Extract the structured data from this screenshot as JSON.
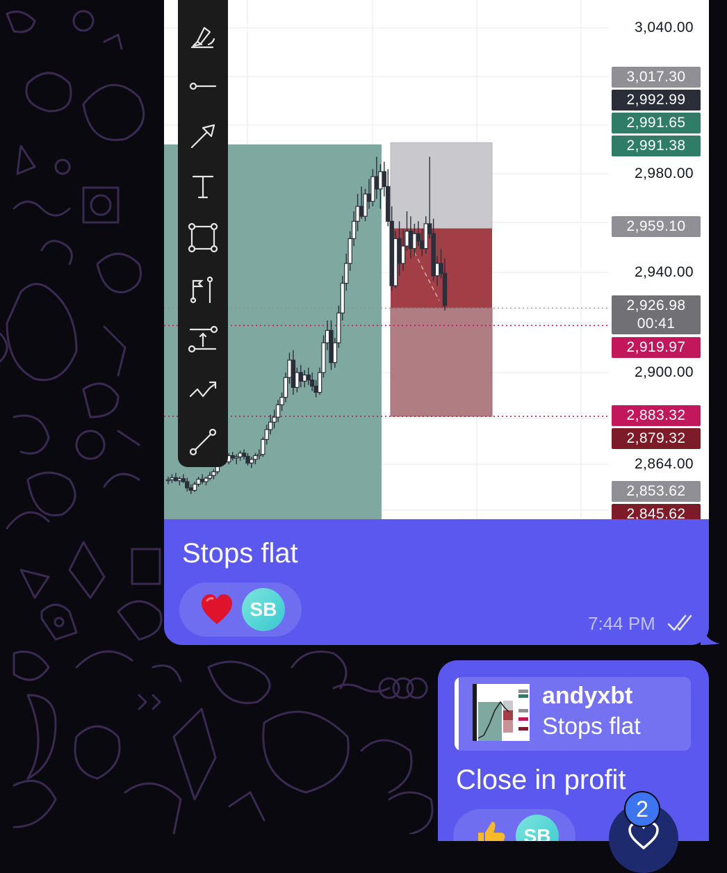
{
  "message1": {
    "caption": "Stops flat",
    "time": "7:44 PM",
    "reactions": [
      {
        "emoji": "heart-emoji"
      },
      {
        "avatar_initials": "SB"
      }
    ]
  },
  "message2": {
    "reply": {
      "author": "andyxbt",
      "text": "Stops flat"
    },
    "caption": "Close in profit",
    "reactions": [
      {
        "emoji": "thumbs-up-emoji"
      },
      {
        "avatar_initials": "SB"
      }
    ],
    "scroll_badge_count": "2"
  },
  "toolbar": {
    "tools": [
      "brush-icon",
      "horizontal-ray-icon",
      "arrow-icon",
      "text-icon",
      "rectangle-icon",
      "flag-pin-icon",
      "price-range-icon",
      "path-icon",
      "trend-line-icon"
    ]
  },
  "chart": {
    "axis_labels": [
      "3,040.00",
      "2,980.00",
      "2,940.00",
      "2,900.00",
      "2,864.00"
    ],
    "price_tags": [
      {
        "value": "3,017.30",
        "color": "#8f8f95"
      },
      {
        "value": "2,992.99",
        "color": "#2a2e39"
      },
      {
        "value": "2,991.65",
        "color": "#2f7d67"
      },
      {
        "value": "2,991.38",
        "color": "#2f7d67"
      },
      {
        "value": "2,959.10",
        "color": "#8f8f95"
      },
      {
        "value": "2,926.98",
        "sub": "00:41",
        "color": "#707075"
      },
      {
        "value": "2,919.97",
        "color": "#c2185b"
      },
      {
        "value": "2,883.32",
        "color": "#c2185b"
      },
      {
        "value": "2,879.32",
        "color": "#7d1c28"
      },
      {
        "value": "2,853.62",
        "color": "#8f8f95"
      },
      {
        "value": "2,845.62",
        "color": "#7d1c28"
      }
    ]
  },
  "colors": {
    "bubble": "#5a58ee",
    "long_zone": "#7fa8a0",
    "stop_zone": "#a13e46",
    "target_zone": "#c9c9cd"
  },
  "chart_data": {
    "type": "candlestick",
    "ylim": [
      2840,
      3048
    ],
    "zones": [
      {
        "name": "long position",
        "top": 2992.99,
        "bottom": 2845.62
      },
      {
        "name": "short target",
        "top": 2993.7,
        "bottom": 2959.1
      },
      {
        "name": "short stop",
        "top": 2959.1,
        "bottom": 2926.98
      },
      {
        "name": "short stop extension",
        "top": 2926.98,
        "bottom": 2883.32
      }
    ],
    "lines": [
      2926.98,
      2919.97,
      2883.32
    ],
    "candles": [
      {
        "o": 2857.5,
        "h": 2859,
        "l": 2856,
        "c": 2857.8
      },
      {
        "o": 2857.8,
        "h": 2860,
        "l": 2856.5,
        "c": 2858.6
      },
      {
        "o": 2858.6,
        "h": 2860.5,
        "l": 2857,
        "c": 2857.4
      },
      {
        "o": 2857.4,
        "h": 2859,
        "l": 2855.5,
        "c": 2858.2
      },
      {
        "o": 2858.2,
        "h": 2860,
        "l": 2856.5,
        "c": 2857
      },
      {
        "o": 2857,
        "h": 2858.5,
        "l": 2853,
        "c": 2854.5
      },
      {
        "o": 2854.5,
        "h": 2856,
        "l": 2852,
        "c": 2853.5
      },
      {
        "o": 2853.5,
        "h": 2857,
        "l": 2852.8,
        "c": 2856
      },
      {
        "o": 2856,
        "h": 2859,
        "l": 2855,
        "c": 2858
      },
      {
        "o": 2858,
        "h": 2860,
        "l": 2856,
        "c": 2857
      },
      {
        "o": 2857,
        "h": 2859,
        "l": 2855.5,
        "c": 2858.4
      },
      {
        "o": 2858.4,
        "h": 2861,
        "l": 2857.5,
        "c": 2859.5
      },
      {
        "o": 2859.5,
        "h": 2862,
        "l": 2858,
        "c": 2861
      },
      {
        "o": 2861,
        "h": 2866,
        "l": 2860,
        "c": 2865
      },
      {
        "o": 2865,
        "h": 2868,
        "l": 2863,
        "c": 2866
      },
      {
        "o": 2866,
        "h": 2869,
        "l": 2864,
        "c": 2865
      },
      {
        "o": 2865,
        "h": 2868.5,
        "l": 2864,
        "c": 2867.5
      },
      {
        "o": 2867.5,
        "h": 2869,
        "l": 2865.5,
        "c": 2866.5
      },
      {
        "o": 2866.5,
        "h": 2868,
        "l": 2864,
        "c": 2867
      },
      {
        "o": 2867,
        "h": 2869.5,
        "l": 2865.5,
        "c": 2868.5
      },
      {
        "o": 2868.5,
        "h": 2870,
        "l": 2866,
        "c": 2867.2
      },
      {
        "o": 2867.2,
        "h": 2868.5,
        "l": 2863.5,
        "c": 2864.5
      },
      {
        "o": 2864.5,
        "h": 2867,
        "l": 2862.5,
        "c": 2866
      },
      {
        "o": 2866,
        "h": 2868.5,
        "l": 2864,
        "c": 2867.5
      },
      {
        "o": 2867.5,
        "h": 2870,
        "l": 2866,
        "c": 2868
      },
      {
        "o": 2868,
        "h": 2875,
        "l": 2867,
        "c": 2874
      },
      {
        "o": 2874,
        "h": 2880,
        "l": 2872,
        "c": 2878
      },
      {
        "o": 2878,
        "h": 2884,
        "l": 2876,
        "c": 2881
      },
      {
        "o": 2881,
        "h": 2886,
        "l": 2878.5,
        "c": 2883
      },
      {
        "o": 2883,
        "h": 2890,
        "l": 2881,
        "c": 2888
      },
      {
        "o": 2888,
        "h": 2893,
        "l": 2885.5,
        "c": 2891
      },
      {
        "o": 2891,
        "h": 2901,
        "l": 2889,
        "c": 2899
      },
      {
        "o": 2899,
        "h": 2909,
        "l": 2896.5,
        "c": 2906
      },
      {
        "o": 2906,
        "h": 2910,
        "l": 2892,
        "c": 2895
      },
      {
        "o": 2895,
        "h": 2903,
        "l": 2893,
        "c": 2901
      },
      {
        "o": 2901,
        "h": 2904,
        "l": 2895,
        "c": 2897.5
      },
      {
        "o": 2897.5,
        "h": 2902,
        "l": 2895,
        "c": 2900
      },
      {
        "o": 2900,
        "h": 2903,
        "l": 2896,
        "c": 2898
      },
      {
        "o": 2898,
        "h": 2901,
        "l": 2893.5,
        "c": 2895.5
      },
      {
        "o": 2895.5,
        "h": 2898,
        "l": 2891,
        "c": 2893
      },
      {
        "o": 2893,
        "h": 2903,
        "l": 2892,
        "c": 2901
      },
      {
        "o": 2901,
        "h": 2916,
        "l": 2899,
        "c": 2913
      },
      {
        "o": 2913,
        "h": 2922,
        "l": 2910,
        "c": 2918
      },
      {
        "o": 2918,
        "h": 2922,
        "l": 2902,
        "c": 2905
      },
      {
        "o": 2905,
        "h": 2915,
        "l": 2903,
        "c": 2913
      },
      {
        "o": 2913,
        "h": 2928,
        "l": 2911,
        "c": 2925
      },
      {
        "o": 2925,
        "h": 2940,
        "l": 2922,
        "c": 2937
      },
      {
        "o": 2937,
        "h": 2949,
        "l": 2934,
        "c": 2945
      },
      {
        "o": 2945,
        "h": 2958,
        "l": 2942,
        "c": 2955
      },
      {
        "o": 2955,
        "h": 2966,
        "l": 2952,
        "c": 2962
      },
      {
        "o": 2962,
        "h": 2973,
        "l": 2958,
        "c": 2968
      },
      {
        "o": 2968,
        "h": 2976,
        "l": 2963,
        "c": 2964
      },
      {
        "o": 2964,
        "h": 2975,
        "l": 2962,
        "c": 2973
      },
      {
        "o": 2973,
        "h": 2979,
        "l": 2967,
        "c": 2970
      },
      {
        "o": 2970,
        "h": 2983,
        "l": 2968,
        "c": 2980
      },
      {
        "o": 2980,
        "h": 2988,
        "l": 2971,
        "c": 2975
      },
      {
        "o": 2975,
        "h": 2985,
        "l": 2967,
        "c": 2982
      },
      {
        "o": 2982,
        "h": 2986,
        "l": 2972,
        "c": 2976
      },
      {
        "o": 2976,
        "h": 2983,
        "l": 2960,
        "c": 2962
      },
      {
        "o": 2962,
        "h": 2968,
        "l": 2934,
        "c": 2936
      },
      {
        "o": 2936,
        "h": 2958,
        "l": 2935,
        "c": 2955
      },
      {
        "o": 2955,
        "h": 2962,
        "l": 2940,
        "c": 2945
      },
      {
        "o": 2945,
        "h": 2959,
        "l": 2942,
        "c": 2952
      },
      {
        "o": 2952,
        "h": 2966,
        "l": 2950,
        "c": 2958
      },
      {
        "o": 2958,
        "h": 2964,
        "l": 2947,
        "c": 2951
      },
      {
        "o": 2951,
        "h": 2961,
        "l": 2948,
        "c": 2957
      },
      {
        "o": 2957,
        "h": 2962,
        "l": 2952,
        "c": 2954
      },
      {
        "o": 2954,
        "h": 2959,
        "l": 2948,
        "c": 2951
      },
      {
        "o": 2951,
        "h": 2964,
        "l": 2949,
        "c": 2961
      },
      {
        "o": 2961,
        "h": 2988,
        "l": 2955,
        "c": 2957
      },
      {
        "o": 2957,
        "h": 2963,
        "l": 2938,
        "c": 2940
      },
      {
        "o": 2940,
        "h": 2948,
        "l": 2936,
        "c": 2945
      },
      {
        "o": 2945,
        "h": 2951,
        "l": 2939,
        "c": 2941
      },
      {
        "o": 2941,
        "h": 2947,
        "l": 2926,
        "c": 2928
      }
    ]
  }
}
